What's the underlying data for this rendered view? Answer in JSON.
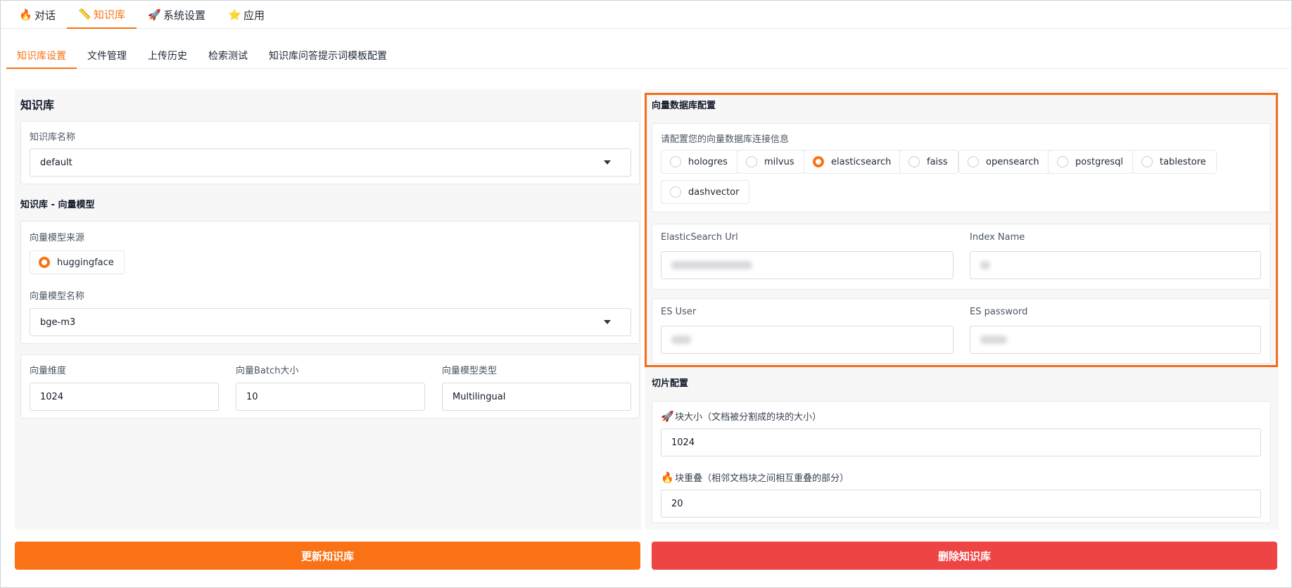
{
  "top_tabs": [
    {
      "icon": "🔥",
      "label": "对话"
    },
    {
      "icon": "📏",
      "label": "知识库"
    },
    {
      "icon": "🚀",
      "label": "系统设置"
    },
    {
      "icon": "⭐",
      "label": "应用"
    }
  ],
  "sub_tabs": [
    "知识库设置",
    "文件管理",
    "上传历史",
    "检索测试",
    "知识库问答提示词模板配置"
  ],
  "kb": {
    "title": "知识库",
    "name_label": "知识库名称",
    "name_value": "default",
    "embed_title": "知识库 - 向量模型",
    "source_label": "向量模型来源",
    "source_option": "huggingface",
    "model_label": "向量模型名称",
    "model_value": "bge-m3",
    "dim_label": "向量维度",
    "dim_value": "1024",
    "batch_label": "向量Batch大小",
    "batch_value": "10",
    "type_label": "向量模型类型",
    "type_value": "Multilingual"
  },
  "vector": {
    "title": "向量数据库配置",
    "hint": "请配置您的向量数据库连接信息",
    "options": [
      "hologres",
      "milvus",
      "elasticsearch",
      "faiss",
      "opensearch",
      "postgresql",
      "tablestore",
      "dashvector"
    ],
    "selected": "elasticsearch",
    "url_label": "ElasticSearch Url",
    "index_label": "Index Name",
    "user_label": "ES User",
    "password_label": "ES password"
  },
  "chunk": {
    "title": "切片配置",
    "size_icon": "🚀",
    "size_label": "块大小（文档被分割成的块的大小）",
    "size_value": "1024",
    "overlap_icon": "🔥",
    "overlap_label": "块重叠（相邻文档块之间相互重叠的部分）",
    "overlap_value": "20"
  },
  "buttons": {
    "update": "更新知识库",
    "delete": "删除知识库"
  },
  "colors": {
    "accent": "#f97316",
    "update_button": "#f97316",
    "delete_button": "#ef4444",
    "highlight_border": "#f26d1c"
  }
}
